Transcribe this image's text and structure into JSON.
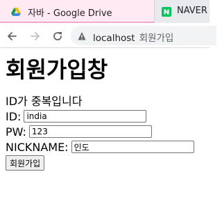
{
  "browser": {
    "tabs": [
      {
        "title": "자바 - Google Drive",
        "active": true,
        "favicon": "google-drive-icon"
      },
      {
        "title": "NAVER",
        "active": false,
        "favicon": "naver-icon"
      }
    ],
    "address": {
      "host": "localhost",
      "page_title": "회원가입"
    }
  },
  "page": {
    "heading": "회원가입창",
    "message": "ID가 중복입니다",
    "form": {
      "id_label": "ID:",
      "id_value": "india",
      "pw_label": "PW:",
      "pw_value": "123",
      "nickname_label": "NICKNAME:",
      "nickname_value": "인도",
      "submit_label": "회원가입"
    }
  },
  "colors": {
    "active_tab_bg": "#ffe9f3",
    "naver_green": "#03c75a"
  }
}
